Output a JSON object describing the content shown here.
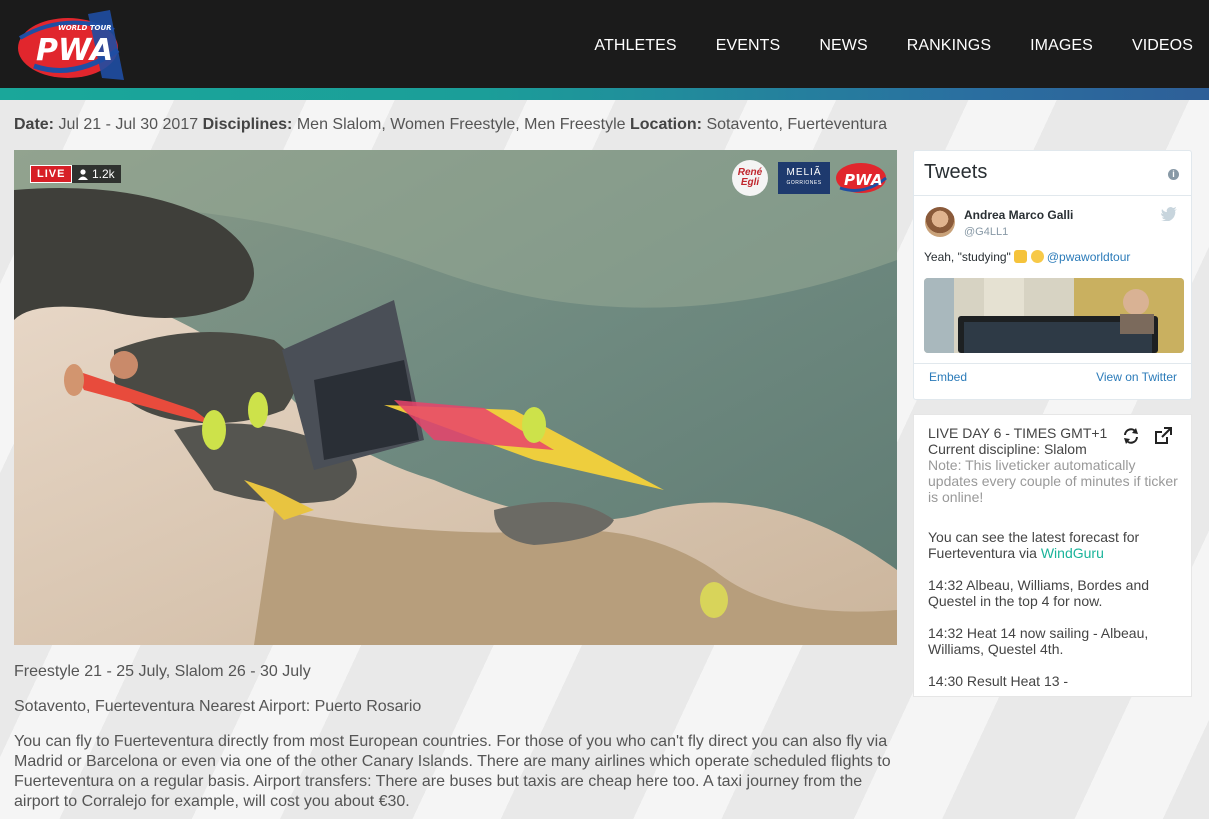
{
  "header": {
    "logo_text": "PWA",
    "logo_subtext": "WORLD TOUR",
    "nav": [
      {
        "label": "ATHLETES"
      },
      {
        "label": "EVENTS"
      },
      {
        "label": "NEWS"
      },
      {
        "label": "RANKINGS"
      },
      {
        "label": "IMAGES"
      },
      {
        "label": "VIDEOS"
      }
    ]
  },
  "event": {
    "date_label": "Date:",
    "date_value": "Jul 21 - Jul 30 2017",
    "disciplines_label": "Disciplines:",
    "disciplines_value": "Men Slalom, Women Freestyle, Men Freestyle",
    "location_label": "Location:",
    "location_value": "Sotavento, Fuerteventura"
  },
  "video": {
    "live_label": "LIVE",
    "viewers": "1.2k",
    "sponsors": {
      "rene": "René Egli",
      "melia": "MELIÃ",
      "melia_sub": "GORRIONES",
      "pwa": "PWA"
    }
  },
  "info": {
    "schedule": "Freestyle 21 - 25 July, Slalom 26 - 30 July",
    "airport": "Sotavento, Fuerteventura Nearest Airport: Puerto Rosario",
    "travel": "You can fly to Fuerteventura directly from most European countries. For those of you who can't fly direct you can also fly via Madrid or Barcelona or even via one of the other Canary Islands. There are many airlines which operate scheduled flights to Fuerteventura on a regular basis. Airport transfers: There are buses but taxis are cheap here too. A taxi journey from the airport to Corralejo for example, will cost you about €30."
  },
  "tweets": {
    "title": "Tweets",
    "tweet": {
      "name": "Andrea Marco Galli",
      "handle": "@G4LL1",
      "text_prefix": "Yeah, \"studying\"",
      "mention": "@pwaworldtour"
    },
    "embed_label": "Embed",
    "view_label": "View on Twitter"
  },
  "ticker": {
    "header": "LIVE DAY 6 - TIMES GMT+1",
    "current": "Current discipline: Slalom",
    "note": "Note: This liveticker automatically updates every couple of minutes if ticker is online!",
    "forecast_prefix": "You can see the latest forecast for Fuerteventura via",
    "forecast_link": "WindGuru",
    "items": [
      "14:32 Albeau, Williams, Bordes and Questel in the top 4 for now.",
      "14:32 Heat 14 now sailing - Albeau, Williams, Questel 4th.",
      "14:30 Result Heat 13 -"
    ]
  },
  "colors": {
    "header_bg": "#1b1b1b",
    "stripe_start": "#1aa79a",
    "stripe_end": "#2e5f98",
    "live_red": "#d71f26",
    "twitter_link": "#2b7bb9",
    "windguru_link": "#1ab49a"
  }
}
